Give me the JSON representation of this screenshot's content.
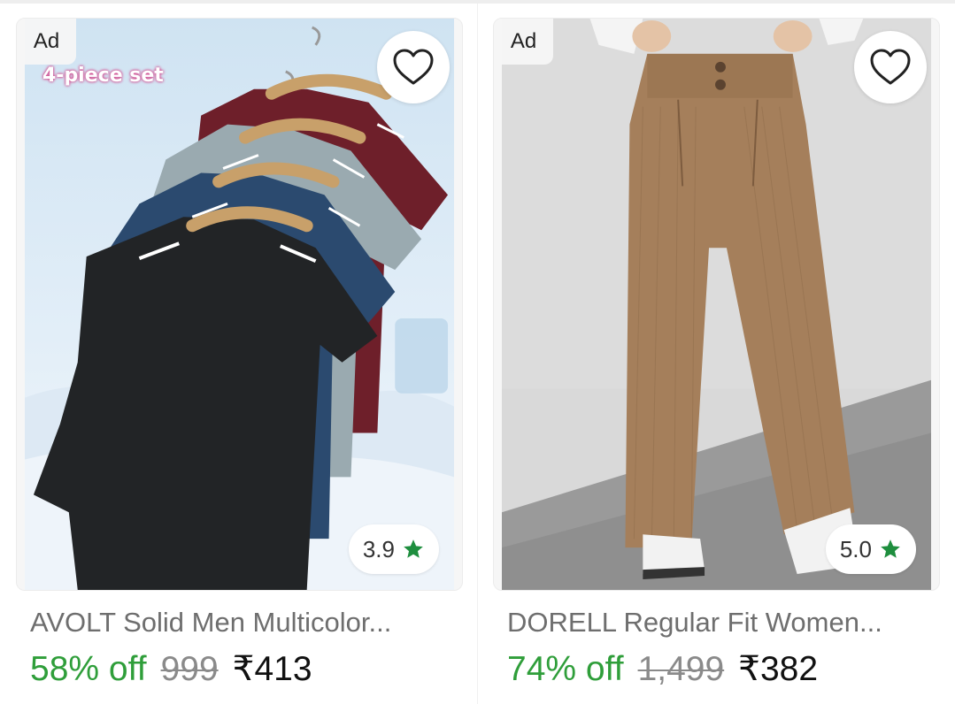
{
  "products": [
    {
      "ad_label": "Ad",
      "image_badge": "4-piece set",
      "rating": "3.9",
      "title": "AVOLT Solid Men Multicolor...",
      "discount": "58% off",
      "mrp": "999",
      "price": "₹413"
    },
    {
      "ad_label": "Ad",
      "rating": "5.0",
      "title": "DORELL Regular Fit Women...",
      "discount": "74% off",
      "mrp": "1,499",
      "price": "₹382"
    }
  ],
  "colors": {
    "discount_green": "#2f9e3a",
    "star_green": "#1e8e3e",
    "title_gray": "#6e6e6e"
  },
  "icons": {
    "wishlist": "heart-outline-icon",
    "rating": "star-icon"
  }
}
